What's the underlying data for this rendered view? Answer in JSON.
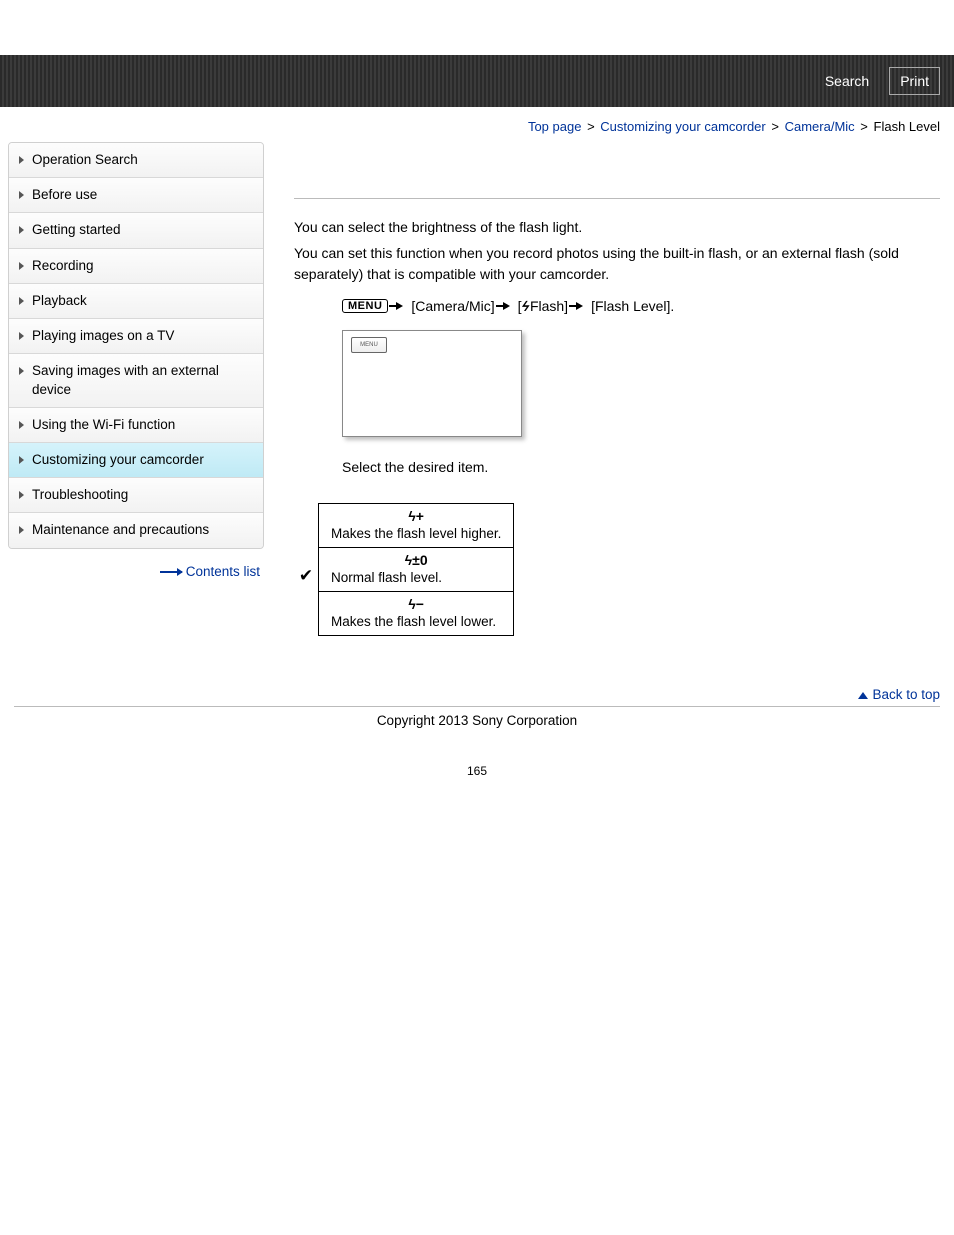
{
  "header": {
    "search": "Search",
    "print": "Print"
  },
  "breadcrumb": {
    "top": "Top page",
    "cust": "Customizing your camcorder",
    "cam": "Camera/Mic",
    "current": "Flash Level"
  },
  "sidebar": {
    "items": [
      {
        "label": "Operation Search"
      },
      {
        "label": "Before use"
      },
      {
        "label": "Getting started"
      },
      {
        "label": "Recording"
      },
      {
        "label": "Playback"
      },
      {
        "label": "Playing images on a TV"
      },
      {
        "label": "Saving images with an external device"
      },
      {
        "label": "Using the Wi-Fi function"
      },
      {
        "label": "Customizing your camcorder"
      },
      {
        "label": "Troubleshooting"
      },
      {
        "label": "Maintenance and precautions"
      }
    ],
    "active_index": 8,
    "contents": "Contents list"
  },
  "article": {
    "p1": "You can select the brightness of the flash light.",
    "p2": "You can set this function when you record photos using the built-in flash, or an external flash (sold separately) that is compatible with your camcorder.",
    "menu_badge": "MENU",
    "path_camera": "[Camera/Mic]",
    "path_flash_pre": "[",
    "path_flash_post": "Flash]",
    "path_level": "[Flash Level].",
    "screenshot_label": "MENU",
    "step2": "Select the desired item.",
    "options": [
      {
        "icon": "ϟ+",
        "desc": "Makes the flash level higher."
      },
      {
        "icon": "ϟ±0",
        "desc": "Normal flash level."
      },
      {
        "icon": "ϟ−",
        "desc": "Makes the flash level lower."
      }
    ],
    "checked_index": 1
  },
  "footer": {
    "back": "Back to top",
    "copyright": "Copyright 2013 Sony Corporation",
    "page": "165"
  }
}
